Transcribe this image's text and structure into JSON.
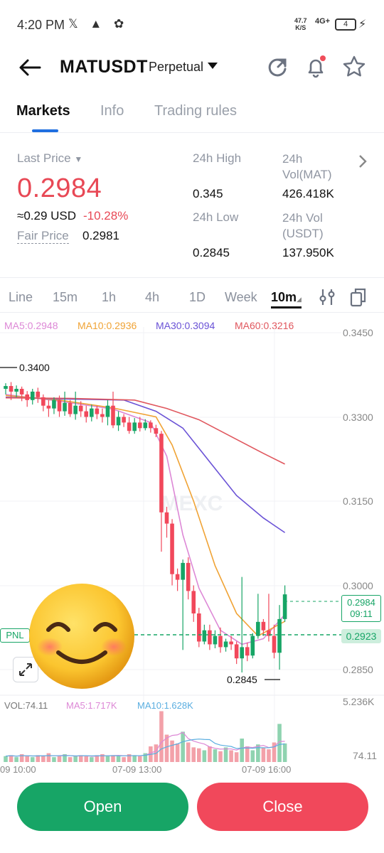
{
  "status_bar": {
    "time": "4:20 PM",
    "net_speed": "47.7",
    "net_unit": "K/S",
    "network": "4G+",
    "battery": "4"
  },
  "header": {
    "symbol": "MATUSDT",
    "contract_type": "Perpetual"
  },
  "tabs": [
    "Markets",
    "Info",
    "Trading rules"
  ],
  "stats": {
    "last_price_label": "Last Price",
    "last_price": "0.2984",
    "usd_value": "≈0.29 USD",
    "change": "-10.28%",
    "fair_price_label": "Fair Price",
    "fair_price": "0.2981",
    "high_label": "24h High",
    "high": "0.345",
    "vol_mat_label": "24h Vol(MAT)",
    "vol_mat": "426.418K",
    "low_label": "24h Low",
    "low": "0.2845",
    "vol_usdt_label": "24h Vol (USDT)",
    "vol_usdt": "137.950K"
  },
  "intervals": [
    "Line",
    "15m",
    "1h",
    "4h",
    "1D",
    "Week",
    "10m"
  ],
  "ma_labels": [
    {
      "text": "MA5:0.2948",
      "color": "#dd88d6"
    },
    {
      "text": "MA10:0.2936",
      "color": "#f0a335"
    },
    {
      "text": "MA30:0.3094",
      "color": "#6a52d6"
    },
    {
      "text": "MA60:0.3216",
      "color": "#e0575e"
    }
  ],
  "y_axis": [
    "0.3450",
    "0.3300",
    "0.3150",
    "0.3000",
    "0.2850"
  ],
  "markers": {
    "high": "0.3400",
    "low": "0.2845",
    "price": "0.2984",
    "countdown": "09:11",
    "pnl_label": "PNL",
    "pnl_price": "0.2923"
  },
  "watermark": "MEXC",
  "volume": {
    "vol": "VOL:74.11",
    "ma5": "MA5:1.717K",
    "ma10": "MA10:1.628K",
    "max": "5.236K",
    "cur": "74.11"
  },
  "x_axis": [
    "09 10:00",
    "07-09 13:00",
    "07-09 16:00"
  ],
  "buttons": {
    "open": "Open",
    "close": "Close"
  },
  "chart_data": {
    "type": "candlestick",
    "interval": "10m",
    "ylim": [
      0.28,
      0.347
    ],
    "candles": [
      [
        0.335,
        0.3355,
        0.334,
        0.336
      ],
      [
        0.3355,
        0.3345,
        0.333,
        0.3362
      ],
      [
        0.3345,
        0.335,
        0.3335,
        0.3356
      ],
      [
        0.335,
        0.334,
        0.3328,
        0.3354
      ],
      [
        0.334,
        0.333,
        0.3318,
        0.3346
      ],
      [
        0.333,
        0.3345,
        0.3322,
        0.335
      ],
      [
        0.3345,
        0.3335,
        0.3325,
        0.3352
      ],
      [
        0.3335,
        0.332,
        0.331,
        0.334
      ],
      [
        0.332,
        0.3315,
        0.33,
        0.333
      ],
      [
        0.3315,
        0.333,
        0.3305,
        0.3335
      ],
      [
        0.333,
        0.331,
        0.33,
        0.3338
      ],
      [
        0.331,
        0.3325,
        0.3302,
        0.3345
      ],
      [
        0.3325,
        0.3305,
        0.33,
        0.333
      ],
      [
        0.3305,
        0.332,
        0.3295,
        0.3345
      ],
      [
        0.332,
        0.331,
        0.33,
        0.3328
      ],
      [
        0.331,
        0.33,
        0.329,
        0.332
      ],
      [
        0.33,
        0.3315,
        0.3292,
        0.3322
      ],
      [
        0.3315,
        0.3305,
        0.3296,
        0.332
      ],
      [
        0.3305,
        0.33,
        0.329,
        0.3315
      ],
      [
        0.33,
        0.332,
        0.3285,
        0.333
      ],
      [
        0.332,
        0.3285,
        0.328,
        0.3345
      ],
      [
        0.3285,
        0.33,
        0.3275,
        0.331
      ],
      [
        0.33,
        0.329,
        0.3282,
        0.3305
      ],
      [
        0.329,
        0.3275,
        0.327,
        0.33
      ],
      [
        0.3275,
        0.329,
        0.327,
        0.3298
      ],
      [
        0.329,
        0.328,
        0.3274,
        0.33
      ],
      [
        0.328,
        0.329,
        0.3276,
        0.3296
      ],
      [
        0.329,
        0.328,
        0.3272,
        0.3294
      ],
      [
        0.328,
        0.327,
        0.3264,
        0.3286
      ],
      [
        0.327,
        0.313,
        0.306,
        0.3275
      ],
      [
        0.313,
        0.311,
        0.3085,
        0.314
      ],
      [
        0.311,
        0.302,
        0.3,
        0.3118
      ],
      [
        0.302,
        0.301,
        0.299,
        0.303
      ],
      [
        0.301,
        0.304,
        0.2885,
        0.3046
      ],
      [
        0.304,
        0.299,
        0.2975,
        0.305
      ],
      [
        0.299,
        0.295,
        0.2935,
        0.3
      ],
      [
        0.295,
        0.29,
        0.289,
        0.296
      ],
      [
        0.29,
        0.292,
        0.2895,
        0.293
      ],
      [
        0.292,
        0.2895,
        0.2885,
        0.293
      ],
      [
        0.2895,
        0.291,
        0.2888,
        0.292
      ],
      [
        0.291,
        0.289,
        0.288,
        0.2925
      ],
      [
        0.289,
        0.29,
        0.2882,
        0.2905
      ],
      [
        0.29,
        0.2895,
        0.2885,
        0.291
      ],
      [
        0.2895,
        0.287,
        0.286,
        0.29
      ],
      [
        0.287,
        0.289,
        0.2845,
        0.3015
      ],
      [
        0.289,
        0.2875,
        0.2865,
        0.2898
      ],
      [
        0.2875,
        0.291,
        0.287,
        0.2915
      ],
      [
        0.291,
        0.2935,
        0.2905,
        0.2985
      ],
      [
        0.2935,
        0.292,
        0.291,
        0.294
      ],
      [
        0.292,
        0.291,
        0.29,
        0.2985
      ],
      [
        0.291,
        0.288,
        0.287,
        0.293
      ],
      [
        0.288,
        0.294,
        0.285,
        0.2965
      ],
      [
        0.294,
        0.2984,
        0.2935,
        0.3
      ]
    ],
    "volume": [
      0.6,
      0.7,
      0.5,
      0.8,
      0.6,
      0.5,
      0.7,
      0.6,
      0.9,
      0.5,
      0.6,
      0.8,
      0.5,
      0.6,
      0.7,
      0.6,
      0.5,
      0.7,
      0.8,
      0.6,
      0.7,
      0.6,
      0.5,
      0.8,
      0.7,
      0.6,
      0.9,
      1.6,
      1.8,
      5.2,
      2.8,
      2.2,
      1.9,
      3.1,
      2.0,
      1.5,
      1.4,
      1.2,
      1.6,
      1.3,
      1.1,
      1.5,
      1.2,
      1.0,
      2.4,
      1.6,
      1.2,
      1.8,
      1.5,
      1.3,
      2.0,
      3.9,
      1.9
    ],
    "ma_lines": {
      "MA5": [
        [
          0,
          0.334
        ],
        [
          10,
          0.3328
        ],
        [
          20,
          0.3314
        ],
        [
          27,
          0.329
        ],
        [
          30,
          0.323
        ],
        [
          33,
          0.309
        ],
        [
          36,
          0.2995
        ],
        [
          40,
          0.292
        ],
        [
          44,
          0.2895
        ],
        [
          48,
          0.2905
        ],
        [
          52,
          0.2948
        ]
      ],
      "MA10": [
        [
          0,
          0.3338
        ],
        [
          10,
          0.333
        ],
        [
          20,
          0.3316
        ],
        [
          28,
          0.33
        ],
        [
          31,
          0.325
        ],
        [
          35,
          0.315
        ],
        [
          39,
          0.3035
        ],
        [
          43,
          0.295
        ],
        [
          47,
          0.291
        ],
        [
          52,
          0.2936
        ]
      ],
      "MA30": [
        [
          0,
          0.3335
        ],
        [
          10,
          0.3332
        ],
        [
          22,
          0.333
        ],
        [
          28,
          0.331
        ],
        [
          33,
          0.328
        ],
        [
          38,
          0.322
        ],
        [
          43,
          0.316
        ],
        [
          48,
          0.312
        ],
        [
          52,
          0.3094
        ]
      ],
      "MA60": [
        [
          0,
          0.3334
        ],
        [
          12,
          0.3333
        ],
        [
          24,
          0.333
        ],
        [
          30,
          0.3315
        ],
        [
          36,
          0.3295
        ],
        [
          42,
          0.3265
        ],
        [
          48,
          0.3235
        ],
        [
          52,
          0.3216
        ]
      ]
    },
    "volume_ma": {
      "MA5": 1.717,
      "MA10": 1.628
    }
  }
}
